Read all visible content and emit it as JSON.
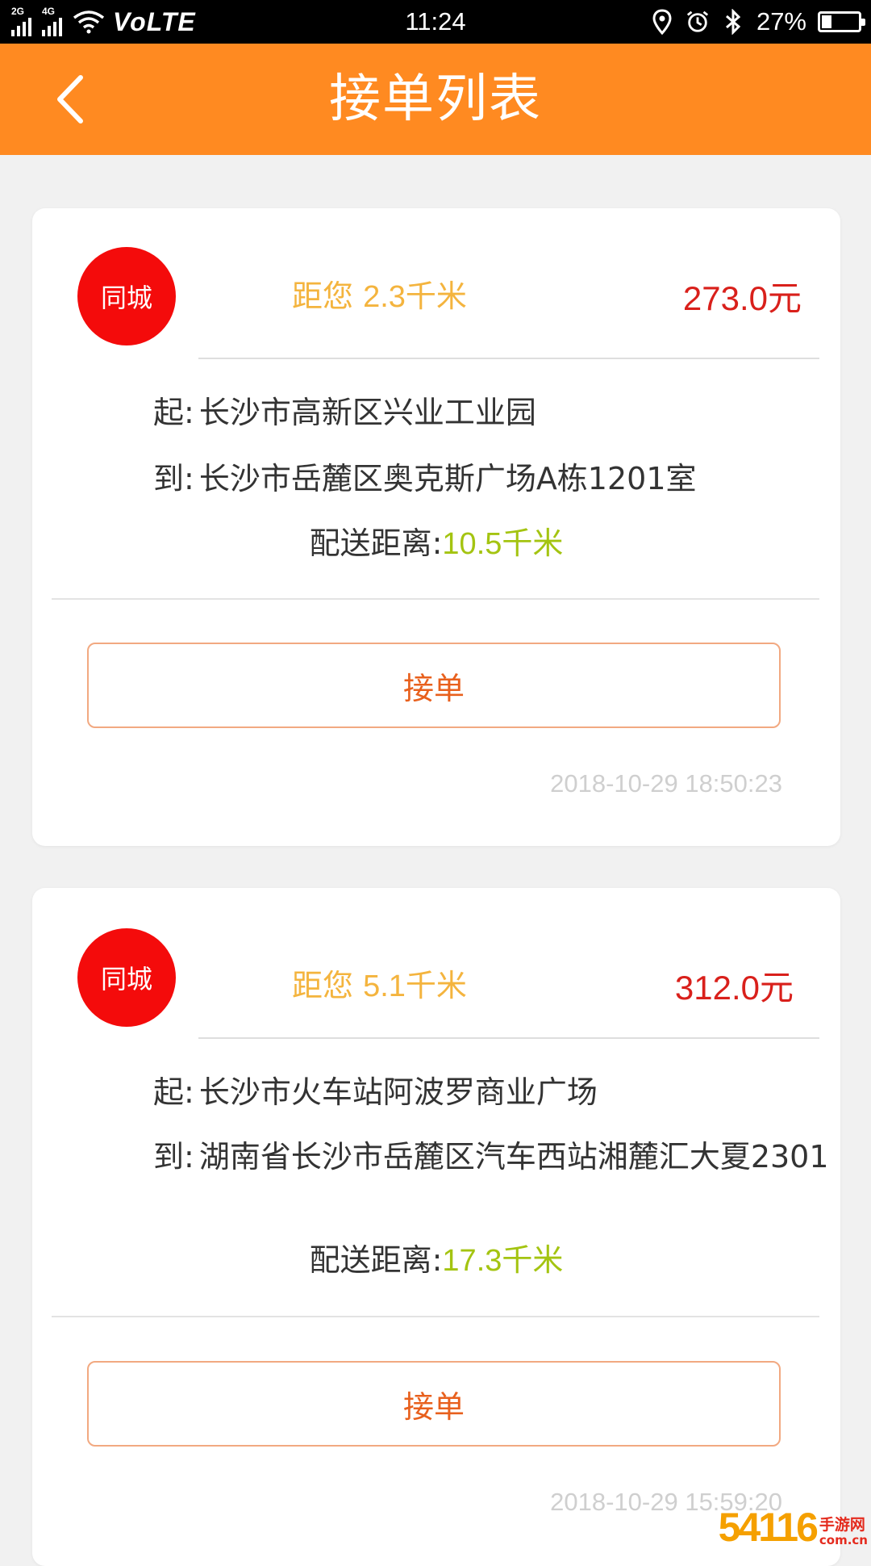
{
  "status_bar": {
    "signal_1_label": "2G",
    "signal_2_label": "4G",
    "network": "VoLTE",
    "time": "11:24",
    "battery_percent": "27%",
    "battery_level": 0.27,
    "icons": [
      "location-icon",
      "alarm-icon",
      "bluetooth-icon"
    ]
  },
  "header": {
    "title": "接单列表",
    "back_icon": "chevron-left-icon"
  },
  "orders": [
    {
      "badge": "同城",
      "distance_prefix": "距您",
      "distance_value": "2.3千米",
      "price": "273.0元",
      "from_label": "起:",
      "from_address": "长沙市高新区兴业工业园",
      "to_label": "到:",
      "to_address": "长沙市岳麓区奥克斯广场A栋1201室",
      "delivery_label": "配送距离:",
      "delivery_value": "10.5千米",
      "accept_label": "接单",
      "timestamp": "2018-10-29 18:50:23"
    },
    {
      "badge": "同城",
      "distance_prefix": "距您",
      "distance_value": "5.1千米",
      "price": "312.0元",
      "from_label": "起:",
      "from_address": "长沙市火车站阿波罗商业广场",
      "to_label": "到:",
      "to_address": "湖南省长沙市岳麓区汽车西站湘麓汇大夏2301",
      "delivery_label": "配送距离:",
      "delivery_value": "17.3千米",
      "accept_label": "接单",
      "timestamp": "2018-10-29 15:59:20"
    }
  ],
  "watermark": {
    "digits": "54116",
    "text": "手游网",
    "domain": "com.cn"
  },
  "colors": {
    "header_bg": "#ff8a21",
    "badge_bg": "#f40b0b",
    "distance": "#f4b43e",
    "price": "#d9201b",
    "delivery_value": "#a4c411",
    "accept_text": "#e8601d",
    "accept_border": "#f2a981"
  }
}
